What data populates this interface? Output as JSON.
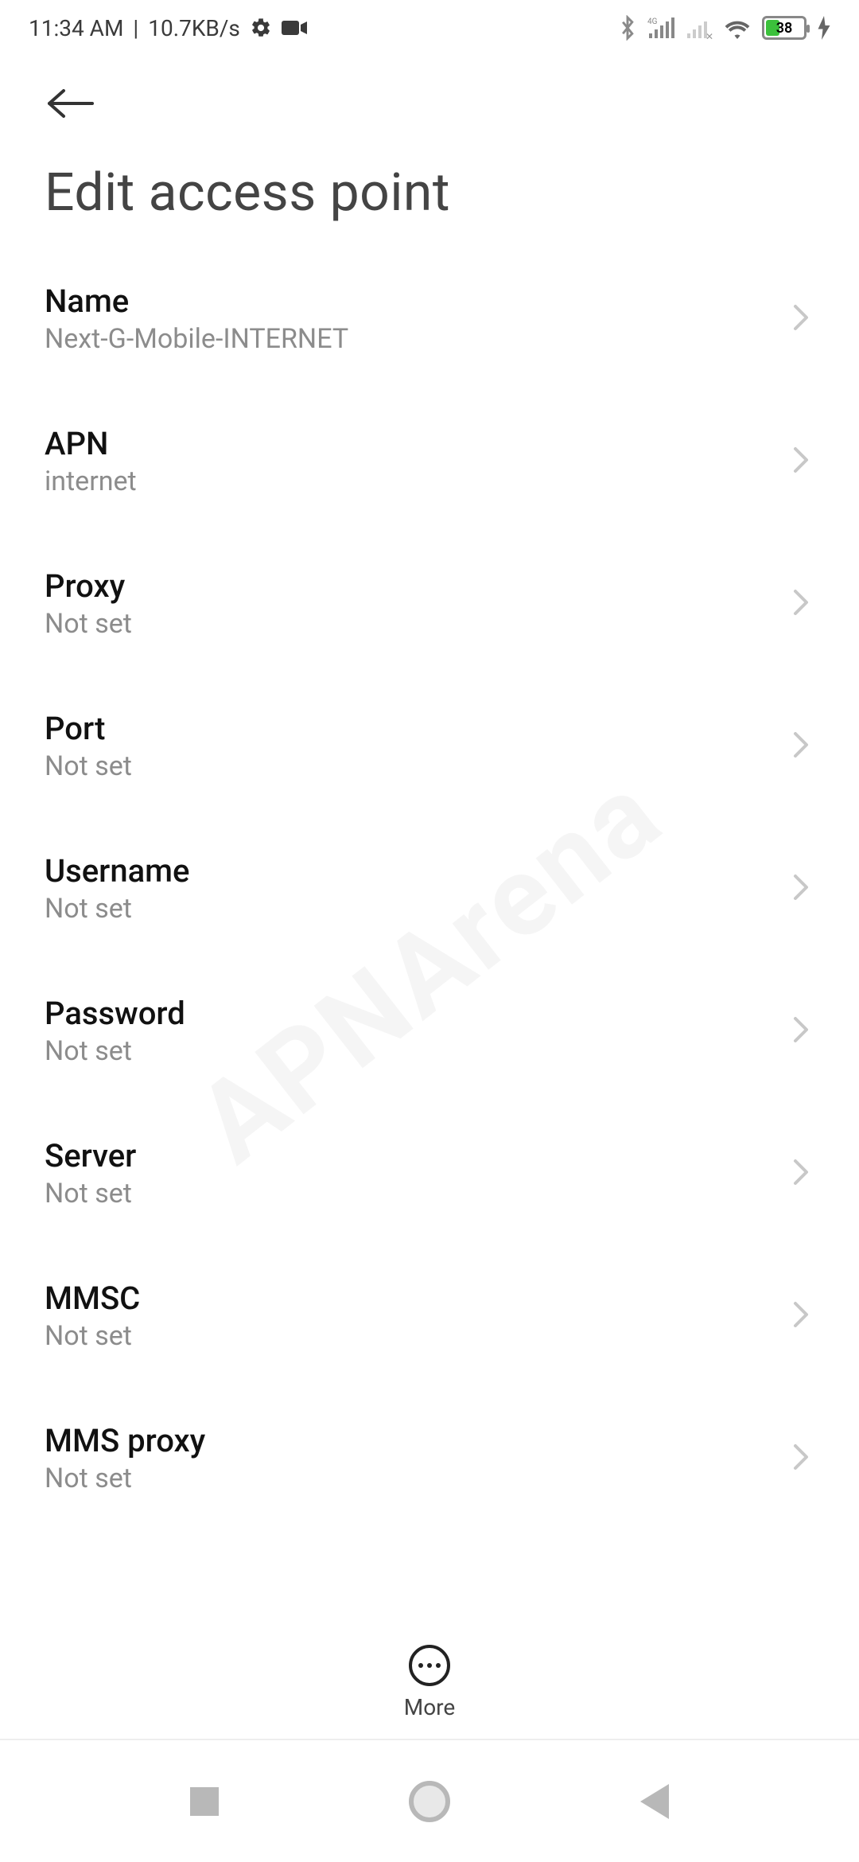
{
  "status": {
    "time": "11:34 AM",
    "separator": "|",
    "speed": "10.7KB/s",
    "battery": "38"
  },
  "page": {
    "title": "Edit access point"
  },
  "settings": [
    {
      "label": "Name",
      "value": "Next-G-Mobile-INTERNET"
    },
    {
      "label": "APN",
      "value": "internet"
    },
    {
      "label": "Proxy",
      "value": "Not set"
    },
    {
      "label": "Port",
      "value": "Not set"
    },
    {
      "label": "Username",
      "value": "Not set"
    },
    {
      "label": "Password",
      "value": "Not set"
    },
    {
      "label": "Server",
      "value": "Not set"
    },
    {
      "label": "MMSC",
      "value": "Not set"
    },
    {
      "label": "MMS proxy",
      "value": "Not set"
    }
  ],
  "actionbar": {
    "more": "More"
  },
  "watermark": "APNArena"
}
